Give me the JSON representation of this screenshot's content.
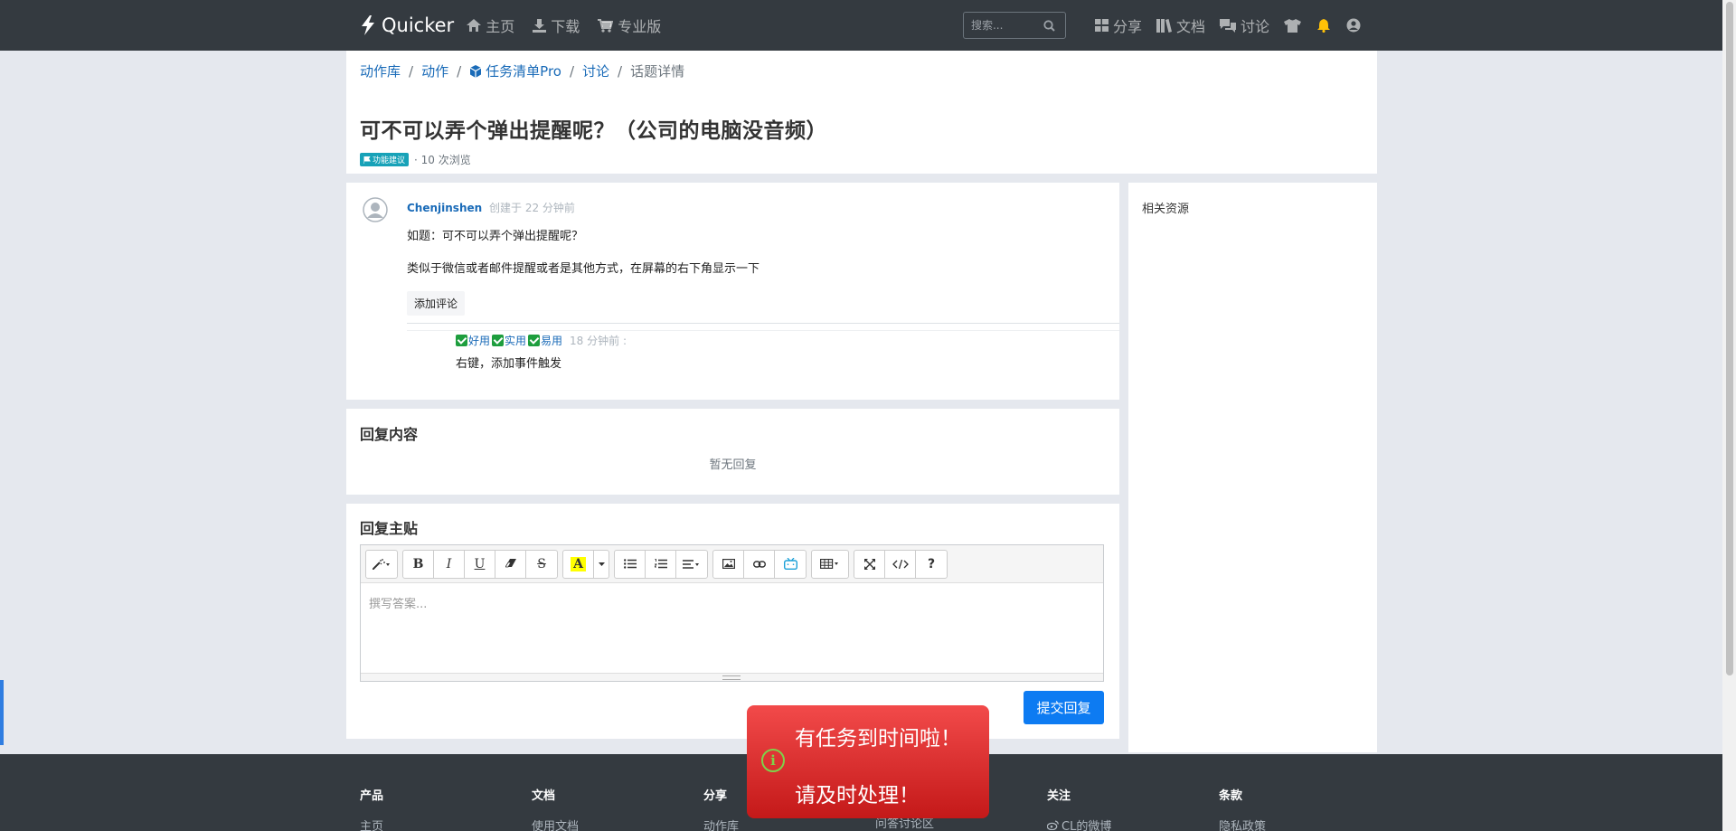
{
  "navbar": {
    "brand": "Quicker",
    "links": [
      {
        "label": "主页",
        "icon": "home-icon"
      },
      {
        "label": "下载",
        "icon": "download-icon"
      },
      {
        "label": "专业版",
        "icon": "cart-icon"
      }
    ],
    "search_placeholder": "搜索...",
    "right_links": [
      {
        "label": "分享",
        "icon": "grid-icon"
      },
      {
        "label": "文档",
        "icon": "books-icon"
      },
      {
        "label": "讨论",
        "icon": "comments-icon"
      }
    ],
    "bell_color": "#ffc107"
  },
  "breadcrumb": {
    "items": [
      "动作库",
      "动作",
      "任务清单Pro",
      "讨论"
    ],
    "current": "话题详情"
  },
  "topic": {
    "title": "可不可以弄个弹出提醒呢？（公司的电脑没音频）",
    "tag": "功能建议",
    "views": "· 10 次浏览"
  },
  "post": {
    "author": "Chenjinshen",
    "created": "创建于 22 分钟前",
    "p1": "如题：可不可以弄个弹出提醒呢？",
    "p2": "类似于微信或者邮件提醒或者是其他方式，在屏幕的右下角显示一下",
    "add_comment": "添加评论"
  },
  "comment": {
    "badges": [
      "好用",
      "实用",
      "易用"
    ],
    "time": "18 分钟前 :",
    "text": "右键，添加事件触发"
  },
  "sidebar": {
    "title": "相关资源"
  },
  "replies": {
    "title": "回复内容",
    "empty": "暂无回复"
  },
  "editor": {
    "title": "回复主贴",
    "placeholder": "撰写答案...",
    "submit": "提交回复"
  },
  "footer": {
    "columns": [
      {
        "heading": "产品",
        "link": "主页"
      },
      {
        "heading": "文档",
        "link": "使用文档"
      },
      {
        "heading": "分享",
        "link": "动作库"
      },
      {
        "heading": "",
        "link": "问答讨论区"
      },
      {
        "heading": "关注",
        "link": "CL的微博"
      },
      {
        "heading": "条款",
        "link": "隐私政策"
      }
    ]
  },
  "toast": {
    "line1": "有任务到时间啦！",
    "line2": "请及时处理！"
  },
  "colors": {
    "link": "#1a6bb8",
    "primary": "#0d7bf2",
    "navbar": "#343a40",
    "tag": "#17a2b8",
    "toast": "#e02a2a"
  }
}
